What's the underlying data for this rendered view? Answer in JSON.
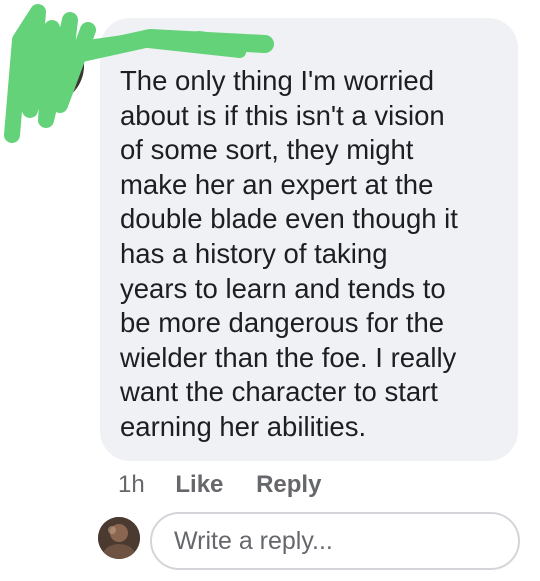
{
  "comment": {
    "author": "",
    "text": "The only thing I'm worried\nabout is if this isn't a vision\nof some sort, they might\nmake her an expert at the\ndouble blade even though it\nhas a history of taking\nyears to learn and tends to\nbe more dangerous for the\nwielder than the foe. I really\nwant the character to start\nearning her abilities.",
    "timestamp": "1h",
    "like_label": "Like",
    "reply_label": "Reply"
  },
  "reply_input": {
    "placeholder": "Write a reply..."
  },
  "colors": {
    "bubble": "#f0f1f4",
    "text": "#1c1e21",
    "secondary_text": "#65676b",
    "redaction_scribble": "#63d278",
    "input_border": "#d3d5d9"
  },
  "icons": {
    "comment_avatar": "user-avatar",
    "reply_avatar": "current-user-avatar"
  }
}
